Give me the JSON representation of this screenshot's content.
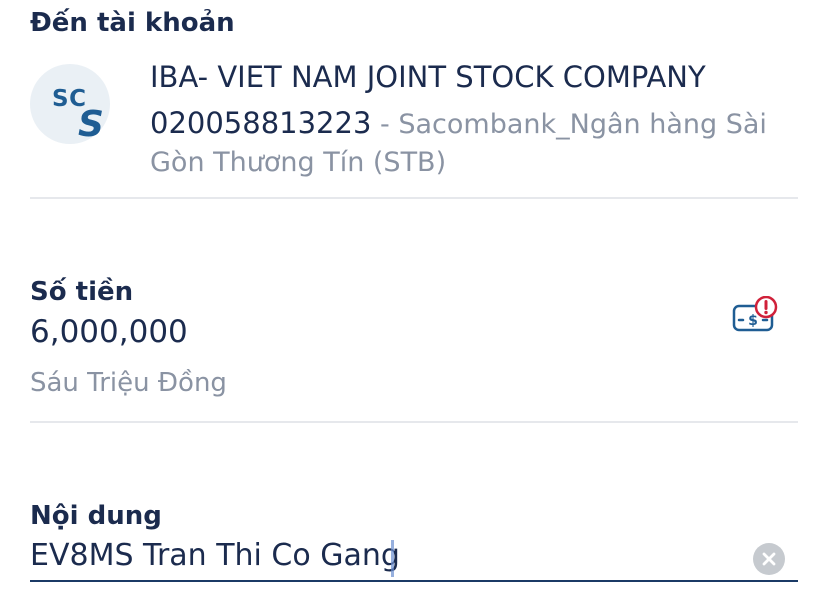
{
  "recipient": {
    "section_label": "Đến tài khoản",
    "logo": {
      "icon": "sacombank-logo-icon",
      "text_top": "SC",
      "text_bottom": "S"
    },
    "account_name": "IBA- VIET NAM JOINT STOCK COMPANY",
    "account_number": "020058813223",
    "bank_separator": " - ",
    "bank_name": "Sacombank_Ngân hàng Sài Gòn Thương Tín (STB)"
  },
  "amount": {
    "section_label": "Số tiền",
    "value": "6,000,000",
    "in_words": "Sáu Triệu Đồng",
    "icon": "money-warning-icon",
    "icon_color": "#1f5d93",
    "warning_color": "#d0213a"
  },
  "content": {
    "section_label": "Nội dung",
    "value": "EV8MS Tran Thi Co Gang",
    "clear_icon": "clear-icon"
  },
  "colors": {
    "text_primary": "#1b2b4e",
    "text_secondary": "#8a93a3",
    "divider": "#e6e8ec",
    "active_underline": "#1b3a66"
  }
}
